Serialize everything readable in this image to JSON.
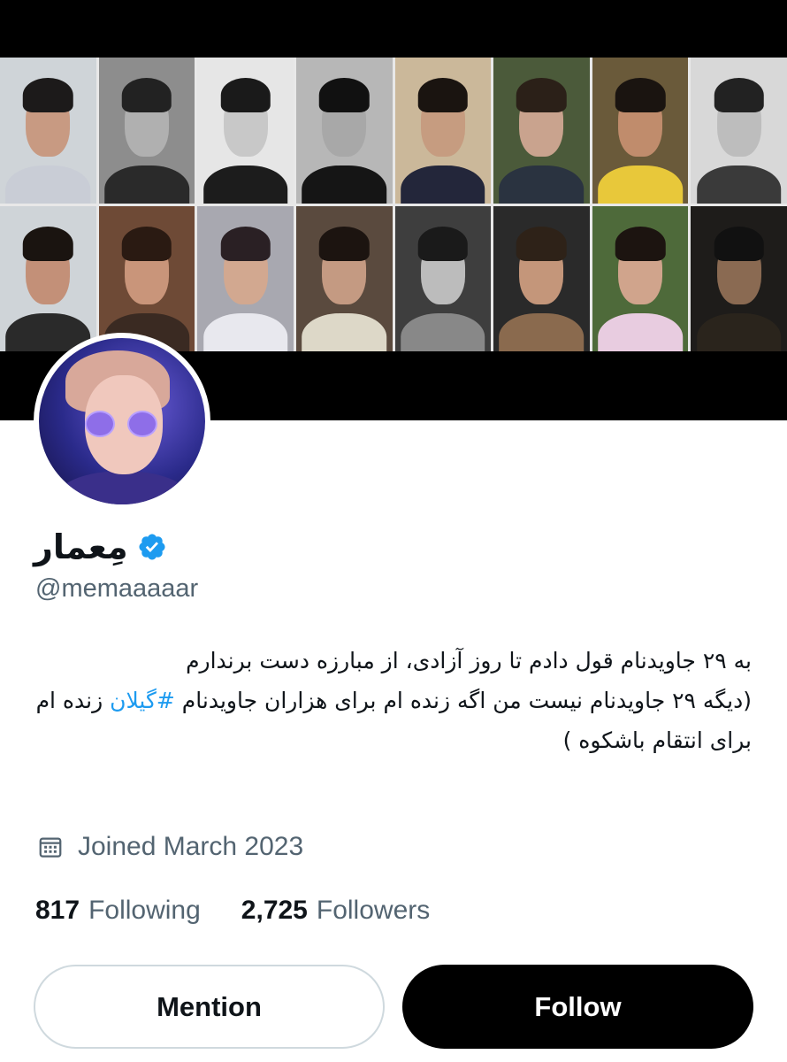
{
  "profile": {
    "display_name": "مِعمار",
    "handle": "@memaaaaar",
    "verified": true,
    "bio": {
      "line1": "به ۲۹ جاویدنام قول دادم تا روز آزادی، از مبارزه دست برندارم",
      "line2": "(دیگه ۲۹ جاویدنام نیست من اگه زنده ام برای هزاران جاویدنام",
      "hashtag": "#گیلان",
      "line2_end": "زنده ام برای انتقام باشکوه )"
    },
    "joined": "Joined March 2023",
    "following_count": "817",
    "following_label": "Following",
    "followers_count": "2,725",
    "followers_label": "Followers"
  },
  "actions": {
    "mention_label": "Mention",
    "follow_label": "Follow"
  },
  "icons": {
    "verified": "verified-badge-icon",
    "calendar": "calendar-icon"
  },
  "colors": {
    "accent": "#1d9bf0",
    "text": "#0f1419",
    "muted": "#536471",
    "banner": "#000000"
  }
}
